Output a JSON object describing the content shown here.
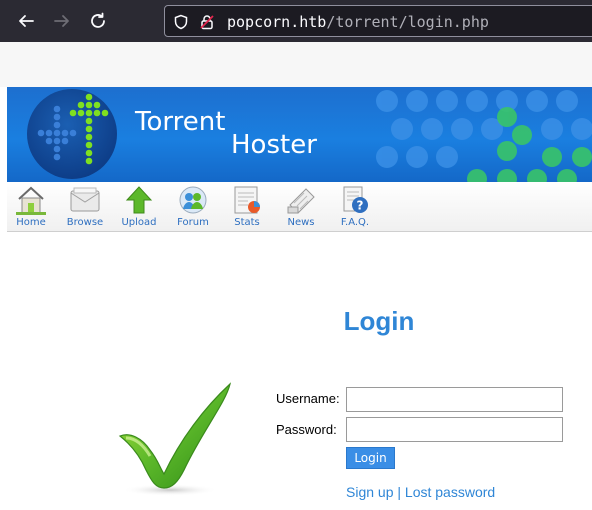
{
  "browser": {
    "url_host": "popcorn.htb",
    "url_path": "/torrent/login.php",
    "icons": [
      "back-icon",
      "forward-icon",
      "reload-icon",
      "shield-icon",
      "insecure-lock-icon"
    ]
  },
  "site": {
    "title_line1": "Torrent",
    "title_line2": "Hoster",
    "colors": {
      "banner": "#1a7fe0",
      "accent": "#2f86d6",
      "dot_green": "#39c469",
      "logo_green": "#7fe020"
    }
  },
  "menu": {
    "items": [
      {
        "label": "Home",
        "icon": "home-icon"
      },
      {
        "label": "Browse",
        "icon": "browse-icon"
      },
      {
        "label": "Upload",
        "icon": "upload-icon"
      },
      {
        "label": "Forum",
        "icon": "forum-icon"
      },
      {
        "label": "Stats",
        "icon": "stats-icon"
      },
      {
        "label": "News",
        "icon": "news-icon"
      },
      {
        "label": "F.A.Q.",
        "icon": "faq-icon"
      }
    ]
  },
  "login": {
    "heading": "Login",
    "username_label": "Username:",
    "username_value": "",
    "password_label": "Password:",
    "password_value": "",
    "button_label": "Login",
    "signup_link": "Sign up",
    "separator": "|",
    "lost_password_link": "Lost password"
  }
}
